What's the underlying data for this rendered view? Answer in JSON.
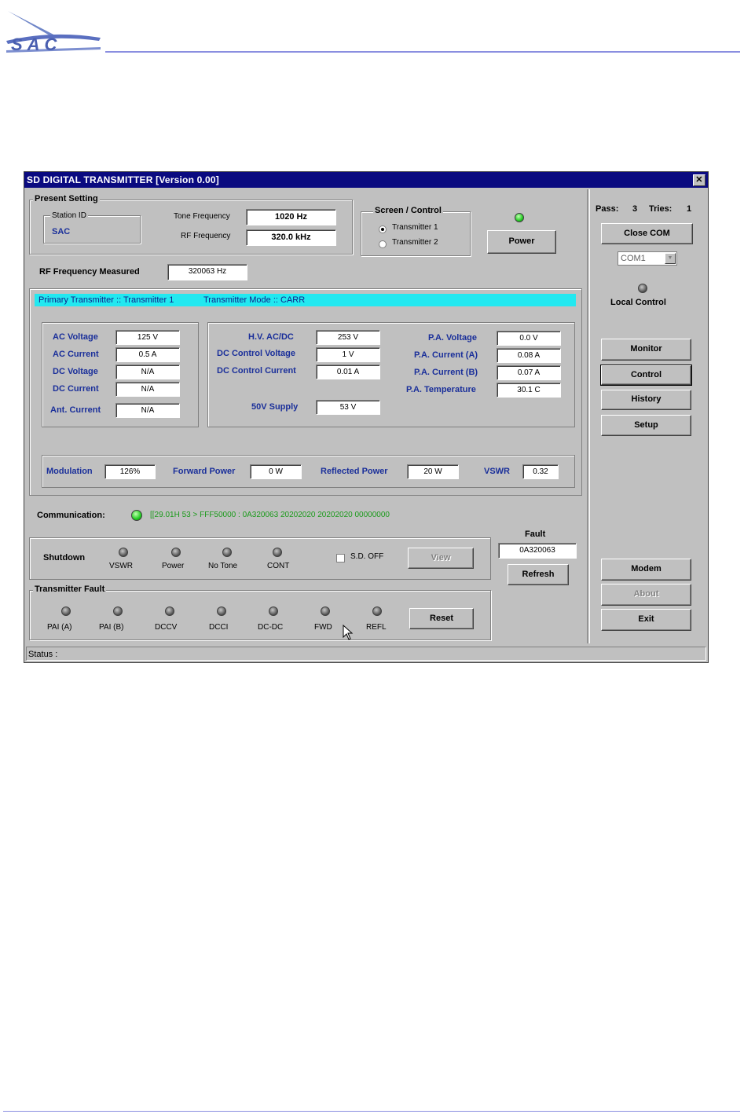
{
  "logo_text": "SAC",
  "window": {
    "title": "SD DIGITAL TRANSMITTER   [Version 0.00]",
    "close_glyph": "✕"
  },
  "present_setting": {
    "group_title": "Present Setting",
    "station_id_label": "Station ID",
    "station_id_value": "SAC",
    "tone_freq_label": "Tone Frequency",
    "tone_freq_value": "1020 Hz",
    "rf_freq_label": "RF Frequency",
    "rf_freq_value": "320.0 kHz"
  },
  "screen_control": {
    "title": "Screen / Control",
    "options": [
      "Transmitter 1",
      "Transmitter 2"
    ],
    "selected": "Transmitter 1"
  },
  "power_button": "Power",
  "rf_measured": {
    "label": "RF Frequency Measured",
    "value": "320063 Hz"
  },
  "mode_bar": {
    "primary": "Primary Transmitter :: Transmitter 1",
    "mode": "Transmitter Mode :: CARR"
  },
  "readings_left": [
    {
      "label": "AC Voltage",
      "value": "125 V"
    },
    {
      "label": "AC Current",
      "value": "0.5 A"
    },
    {
      "label": "DC Voltage",
      "value": "N/A"
    },
    {
      "label": "DC Current",
      "value": "N/A"
    },
    {
      "label": "Ant. Current",
      "value": "N/A"
    }
  ],
  "readings_mid": [
    {
      "label": "H.V. AC/DC",
      "value": "253 V"
    },
    {
      "label": "DC Control Voltage",
      "value": "1 V"
    },
    {
      "label": "DC Control Current",
      "value": "0.01 A"
    },
    {
      "label": "50V Supply",
      "value": "53 V"
    }
  ],
  "readings_right": [
    {
      "label": "P.A. Voltage",
      "value": "0.0 V"
    },
    {
      "label": "P.A. Current (A)",
      "value": "0.08 A"
    },
    {
      "label": "P.A. Current (B)",
      "value": "0.07 A"
    },
    {
      "label": "P.A. Temperature",
      "value": "30.1 C"
    }
  ],
  "bottom_readings": [
    {
      "label": "Modulation",
      "value": "126%"
    },
    {
      "label": "Forward Power",
      "value": "0 W"
    },
    {
      "label": "Reflected Power",
      "value": "20 W"
    },
    {
      "label": "VSWR",
      "value": "0.32"
    }
  ],
  "communication": {
    "label": "Communication:",
    "text": "[[29.01H 53 > FFF50000 : 0A320063 20202020 20202020 00000000"
  },
  "shutdown": {
    "label": "Shutdown",
    "indicators": [
      "VSWR",
      "Power",
      "No Tone",
      "CONT"
    ],
    "sd_off_label": "S.D. OFF",
    "view_button": "View"
  },
  "fault": {
    "label": "Fault",
    "value": "0A320063",
    "refresh_button": "Refresh"
  },
  "transmitter_fault": {
    "title": "Transmitter Fault",
    "indicators": [
      "PAI (A)",
      "PAI (B)",
      "DCCV",
      "DCCI",
      "DC-DC",
      "FWD",
      "REFL"
    ],
    "reset_button": "Reset"
  },
  "right_panel": {
    "pass_label": "Pass:",
    "pass_value": "3",
    "tries_label": "Tries:",
    "tries_value": "1",
    "close_com": "Close COM",
    "com_port": "COM1",
    "local_control": "Local Control",
    "monitor": "Monitor",
    "control": "Control",
    "history": "History",
    "setup": "Setup",
    "modem": "Modem",
    "about": "About",
    "exit": "Exit"
  },
  "status_bar": "Status :"
}
